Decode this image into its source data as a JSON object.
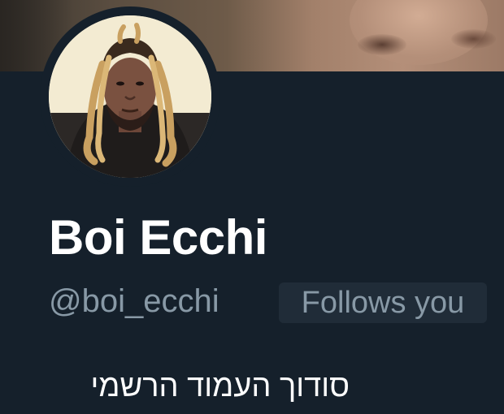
{
  "profile": {
    "display_name": "Boi Ecchi",
    "handle": "@boi_ecchi",
    "follows_badge": "Follows you",
    "bio": "סודוך העמוד הרשמי"
  },
  "colors": {
    "background": "#15202b",
    "name_text": "#ffffff",
    "secondary_text": "#8899a6",
    "badge_background": "#202c38"
  }
}
